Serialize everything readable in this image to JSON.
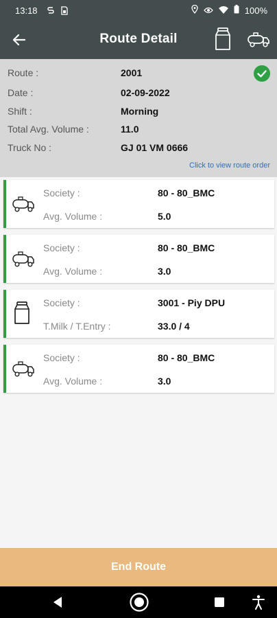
{
  "status_bar": {
    "time": "13:18",
    "battery": "100%",
    "icons": [
      "s-notification-icon",
      "sim-icon",
      "location-icon",
      "eye-icon",
      "wifi-icon",
      "battery-icon"
    ]
  },
  "app_bar": {
    "title": "Route Detail",
    "icons": [
      "back-arrow-icon",
      "milk-can-icon",
      "tanker-truck-icon"
    ]
  },
  "summary": {
    "route_label": "Route :",
    "route_value": "2001",
    "date_label": "Date :",
    "date_value": "02-09-2022",
    "shift_label": "Shift :",
    "shift_value": "Morning",
    "volume_label": "Total Avg. Volume :",
    "volume_value": "11.0",
    "truck_label": "Truck No :",
    "truck_value": "GJ 01 VM 0666",
    "status_icon": "check-circle-icon",
    "route_order_link": "Click to view route order"
  },
  "stops": [
    {
      "icon": "tanker-truck-icon",
      "label1": "Society :",
      "value1": "80 - 80_BMC",
      "label2": "Avg. Volume :",
      "value2": "5.0"
    },
    {
      "icon": "tanker-truck-icon",
      "label1": "Society :",
      "value1": "80 - 80_BMC",
      "label2": "Avg. Volume :",
      "value2": "3.0"
    },
    {
      "icon": "milk-can-icon",
      "label1": "Society :",
      "value1": "3001 - Piy DPU",
      "label2": "T.Milk / T.Entry :",
      "value2": "33.0 / 4"
    },
    {
      "icon": "tanker-truck-icon",
      "label1": "Society :",
      "value1": "80 - 80_BMC",
      "label2": "Avg. Volume :",
      "value2": "3.0"
    }
  ],
  "end_button": "End Route",
  "colors": {
    "app_bar": "#434d4d",
    "summary_bg": "#d7d7d7",
    "accent_green": "#2ea043",
    "end_button": "#eab97f",
    "link": "#2f6fb8"
  },
  "nav_bar": {
    "icons": [
      "back-triangle-icon",
      "home-circle-icon",
      "recents-square-icon",
      "accessibility-icon"
    ]
  }
}
